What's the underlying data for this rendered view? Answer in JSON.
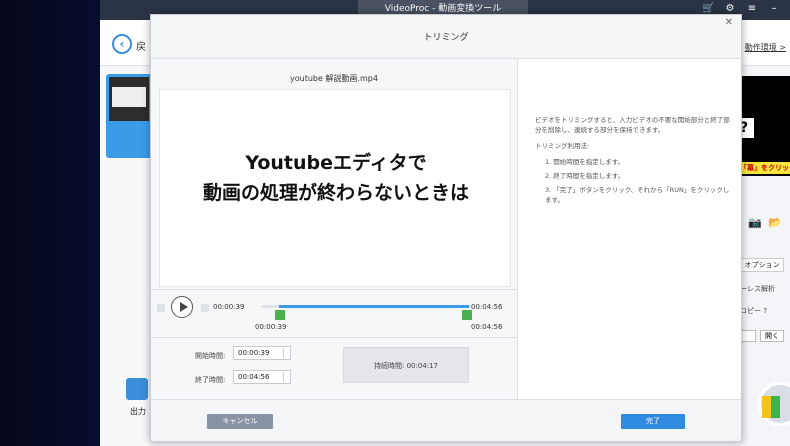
{
  "window": {
    "title": "VideoProc - 動画変換ツール"
  },
  "topbar": {
    "back_label": "戻",
    "env_link": "動作環境 >"
  },
  "left": {
    "output_label": "出力"
  },
  "right": {
    "question_mark": "?",
    "ad_text": "「幕」をクリック!",
    "option_label": "オプション",
    "text1": "ーレス解析",
    "text2": "コピー ?",
    "btn2": "開く"
  },
  "dialog": {
    "title": "トリミング",
    "file_name": "youtube 解説動画.mp4",
    "preview": {
      "line1": "Youtubeエディタで",
      "line2": "動画の処理が終わらないときは"
    },
    "timeline": {
      "current": "00:00:39",
      "end": "00:04:56",
      "start_marker": "00:00:39",
      "end_marker": "00:04:56",
      "trim_start_fraction": 0.13,
      "trim_end_fraction": 1.0
    },
    "fields": {
      "start_label": "開始時間:",
      "start_value": "00:00:39",
      "end_label": "終了時間:",
      "end_value": "00:04:56",
      "duration": "持続時間: 00:04:17"
    },
    "help": {
      "intro": "ビデオをトリミングすると、入力ビデオの不要な開始部分と終了部分を削除し、連続する部分を保持できます。",
      "usage_title": "トリミング利用法:",
      "steps": [
        "1. 開始時間を指定します。",
        "2. 終了時間を指定します。",
        "3. 「完了」ボタンをクリック、それから「RUN」をクリックします。"
      ]
    },
    "buttons": {
      "cancel": "キャンセル",
      "done": "完了"
    }
  }
}
